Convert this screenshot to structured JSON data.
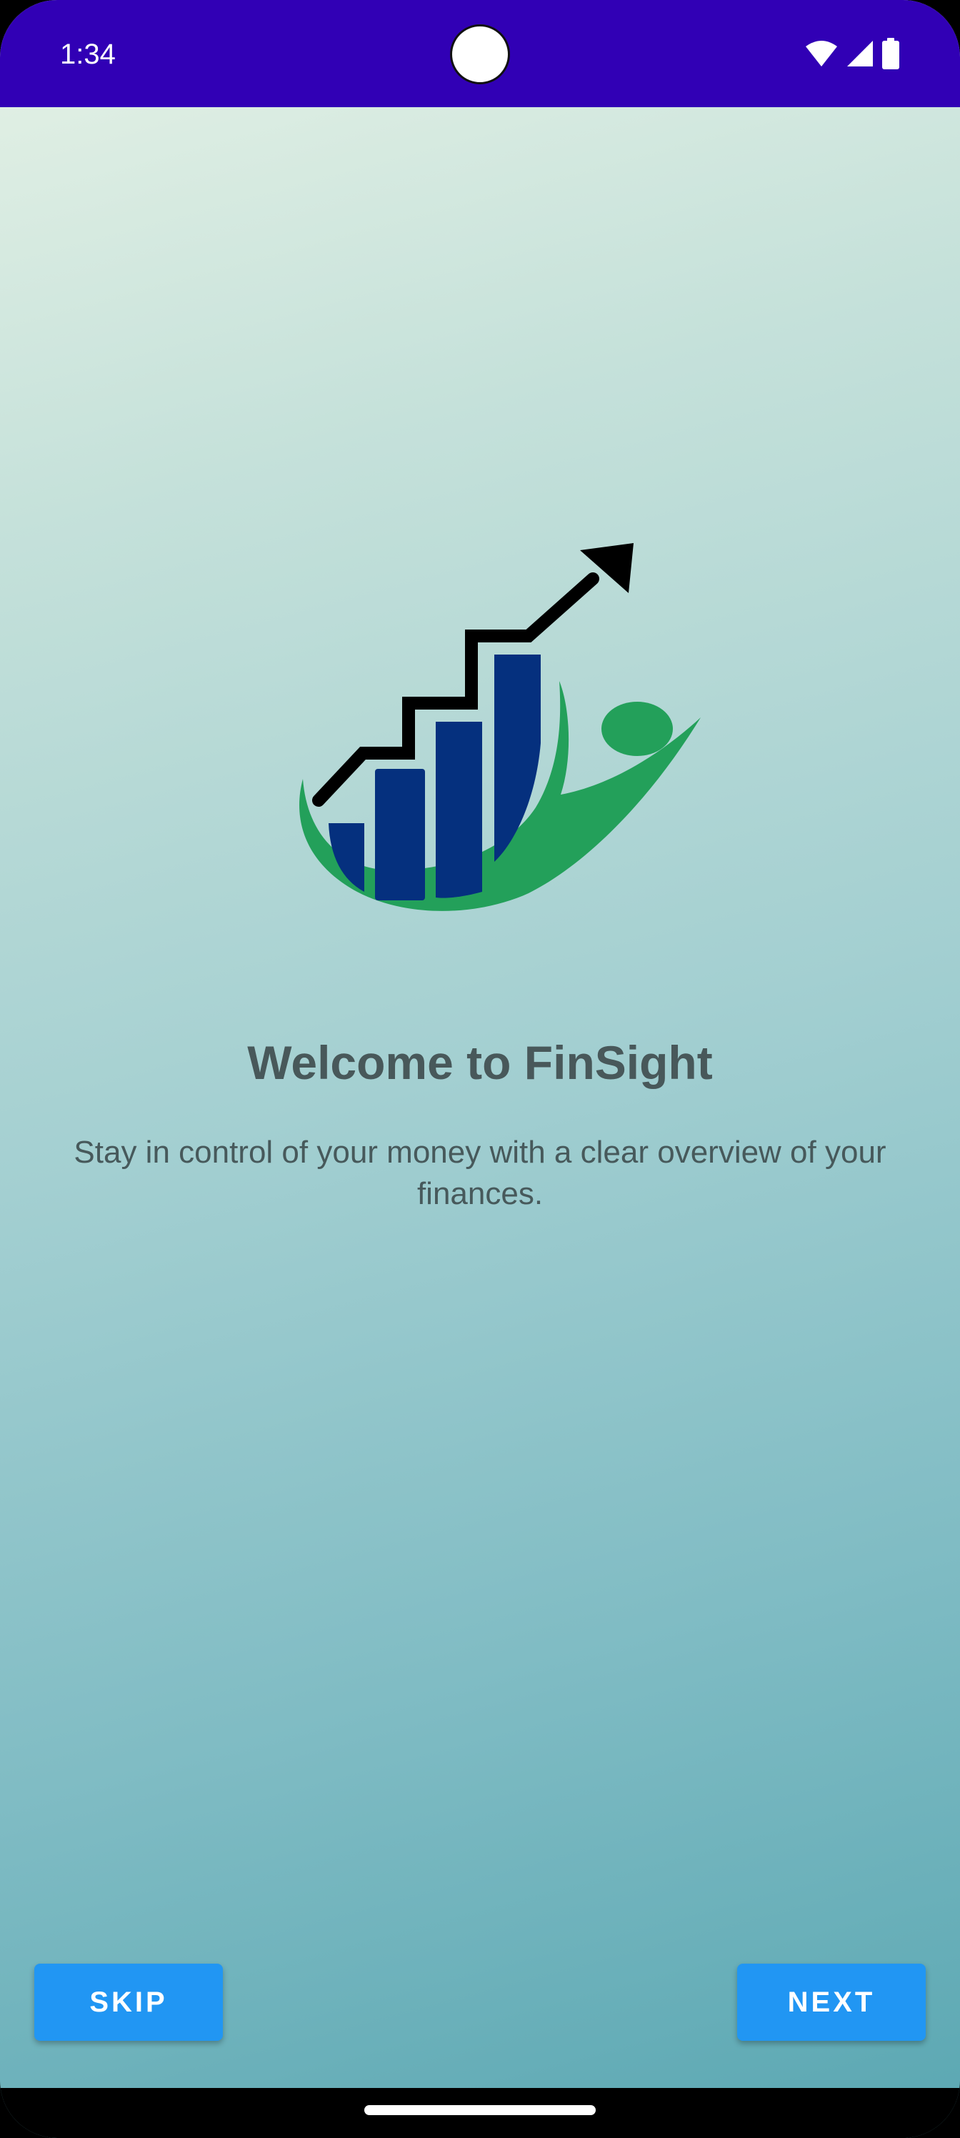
{
  "status_bar": {
    "time": "1:34",
    "icons": [
      "wifi-icon",
      "signal-icon",
      "battery-icon"
    ],
    "background_color": "#3100b5"
  },
  "onboarding": {
    "logo_icon": "finsight-logo-icon",
    "title": "Welcome to FinSight",
    "subtitle": "Stay in control of your money with a clear overview of your finances."
  },
  "actions": {
    "skip_label": "SKIP",
    "next_label": "NEXT",
    "button_color": "#2196f3"
  },
  "colors": {
    "logo_bars": "#05307e",
    "logo_swoosh": "#23a05a",
    "logo_arrow": "#000000",
    "text": "#48585a"
  }
}
